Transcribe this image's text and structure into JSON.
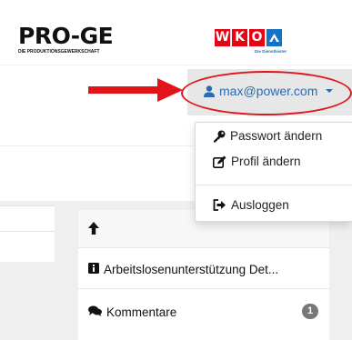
{
  "header": {
    "proge_logo": {
      "word": "PRO-GE",
      "tagline": "DIE PRODUKTIONSGEWERKSCHAFT"
    },
    "wko_logo": {
      "letters": [
        "W",
        "K",
        "O"
      ],
      "tagline": "Die Dienstleister"
    }
  },
  "user_menu": {
    "email": "max@power.com",
    "items": [
      {
        "label": "Passwort ändern",
        "icon": "key-icon"
      },
      {
        "label": "Profil ändern",
        "icon": "edit-icon"
      },
      {
        "label": "Ausloggen",
        "icon": "sign-out-icon"
      }
    ]
  },
  "side_panel": {
    "up_icon": "arrow-up-icon",
    "rows": [
      {
        "label": "Arbeitslosenunterstützung Det...",
        "icon": "info-icon"
      },
      {
        "label": "Kommentare",
        "icon": "comments-icon",
        "badge": "1"
      }
    ]
  },
  "colors": {
    "accent": "#2a6cb0",
    "highlight": "#e2141a",
    "wko_red": "#e30613",
    "wko_blue": "#1673c4"
  }
}
